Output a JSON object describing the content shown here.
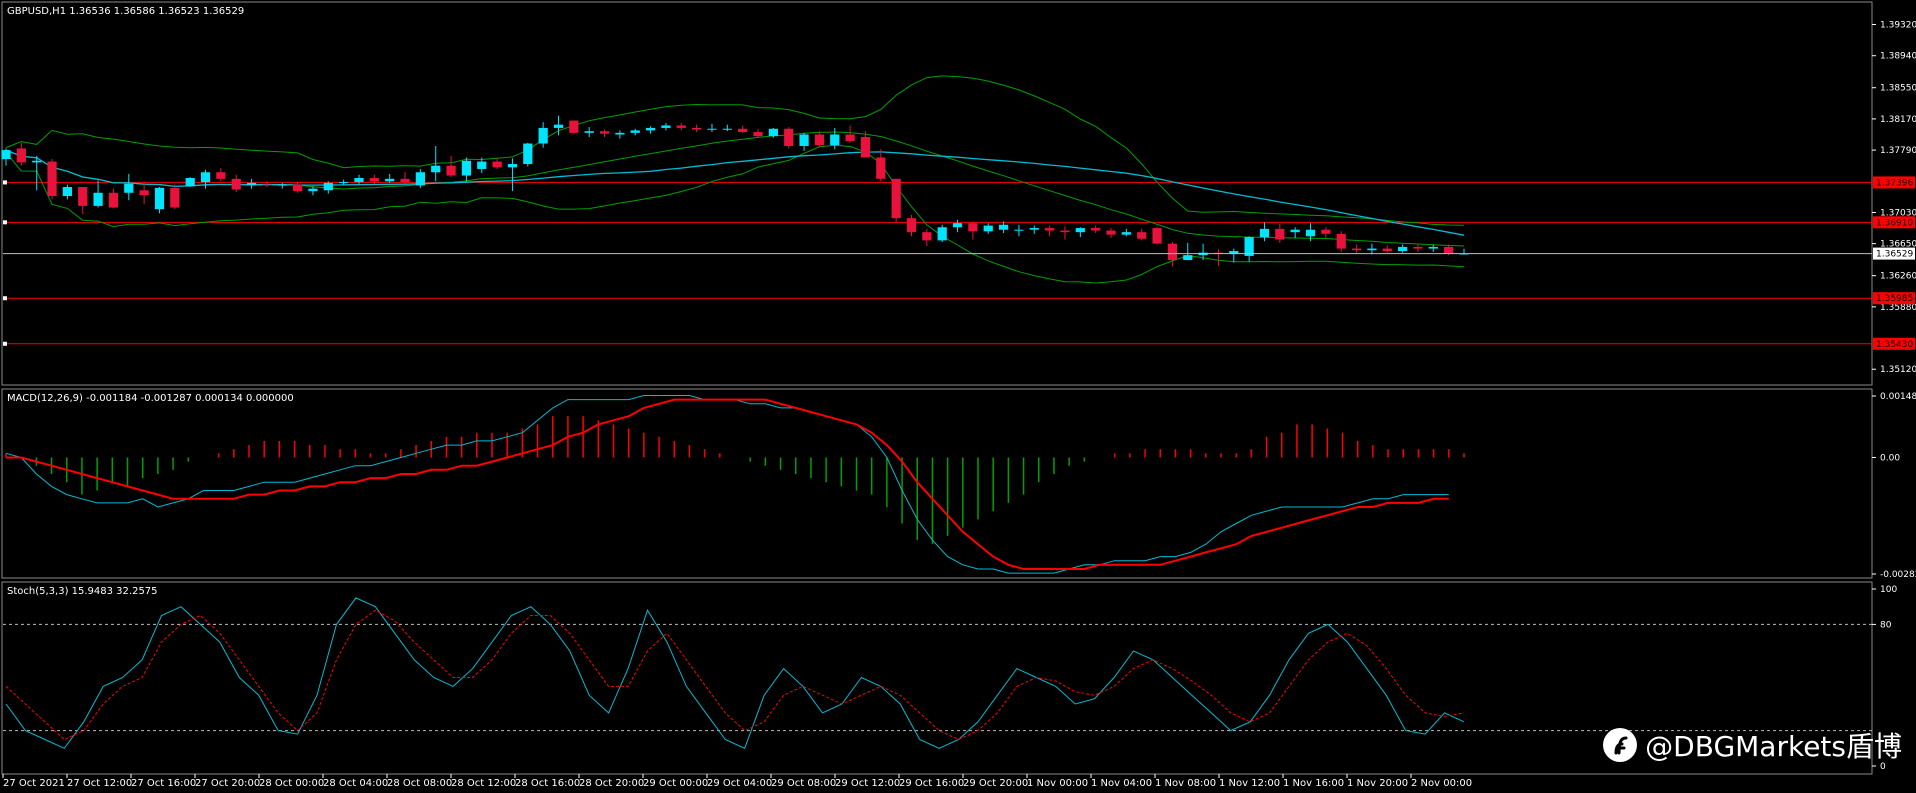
{
  "chart_data": [
    {
      "type": "candlestick",
      "title": "GBPUSD,H1  1.36536 1.36586 1.36523 1.36529",
      "symbol": "GBPUSD",
      "timeframe": "H1",
      "ylim": [
        1.3494,
        1.3957
      ],
      "y_ticks": [
        "1.39320",
        "1.38940",
        "1.38550",
        "1.38170",
        "1.37790",
        "1.37030",
        "1.36650",
        "1.36260",
        "1.35880",
        "1.35120"
      ],
      "current_price": "1.36529",
      "price_lines": [
        "1.37396",
        "1.36910",
        "1.35985",
        "1.35430"
      ],
      "bollinger": {
        "period": 20,
        "color": "#00a000"
      },
      "moving_average": {
        "color": "#00bcd4"
      },
      "colors": {
        "up": "#00e5ff",
        "down": "#e8123c",
        "level": "#ff0000"
      },
      "candles": [
        {
          "o": 1.3768,
          "h": 1.3781,
          "l": 1.376,
          "c": 1.3779
        },
        {
          "o": 1.3781,
          "h": 1.3788,
          "l": 1.376,
          "c": 1.3764
        },
        {
          "o": 1.3764,
          "h": 1.3772,
          "l": 1.373,
          "c": 1.3766
        },
        {
          "o": 1.3765,
          "h": 1.3768,
          "l": 1.3719,
          "c": 1.3723
        },
        {
          "o": 1.3723,
          "h": 1.3737,
          "l": 1.3719,
          "c": 1.3734
        },
        {
          "o": 1.3734,
          "h": 1.3734,
          "l": 1.3701,
          "c": 1.3711
        },
        {
          "o": 1.3711,
          "h": 1.3742,
          "l": 1.3709,
          "c": 1.3727
        },
        {
          "o": 1.3727,
          "h": 1.3732,
          "l": 1.3708,
          "c": 1.3709
        },
        {
          "o": 1.3727,
          "h": 1.375,
          "l": 1.3718,
          "c": 1.3738
        },
        {
          "o": 1.373,
          "h": 1.374,
          "l": 1.3713,
          "c": 1.3724
        },
        {
          "o": 1.3707,
          "h": 1.3734,
          "l": 1.3702,
          "c": 1.3733
        },
        {
          "o": 1.3733,
          "h": 1.3737,
          "l": 1.3707,
          "c": 1.3709
        },
        {
          "o": 1.3735,
          "h": 1.3746,
          "l": 1.3734,
          "c": 1.3745
        },
        {
          "o": 1.374,
          "h": 1.3755,
          "l": 1.3732,
          "c": 1.3752
        },
        {
          "o": 1.3752,
          "h": 1.3757,
          "l": 1.3741,
          "c": 1.3744
        },
        {
          "o": 1.3744,
          "h": 1.3749,
          "l": 1.3728,
          "c": 1.3731
        },
        {
          "o": 1.3736,
          "h": 1.3744,
          "l": 1.3732,
          "c": 1.3739
        },
        {
          "o": 1.3737,
          "h": 1.3741,
          "l": 1.3734,
          "c": 1.3736
        },
        {
          "o": 1.3736,
          "h": 1.3739,
          "l": 1.3732,
          "c": 1.3737
        },
        {
          "o": 1.3737,
          "h": 1.374,
          "l": 1.3727,
          "c": 1.3729
        },
        {
          "o": 1.3729,
          "h": 1.3735,
          "l": 1.3724,
          "c": 1.3732
        },
        {
          "o": 1.373,
          "h": 1.3741,
          "l": 1.3726,
          "c": 1.3739
        },
        {
          "o": 1.3739,
          "h": 1.3743,
          "l": 1.3736,
          "c": 1.374
        },
        {
          "o": 1.374,
          "h": 1.3749,
          "l": 1.3737,
          "c": 1.3745
        },
        {
          "o": 1.3745,
          "h": 1.3749,
          "l": 1.3738,
          "c": 1.3741
        },
        {
          "o": 1.3741,
          "h": 1.375,
          "l": 1.3739,
          "c": 1.3744
        },
        {
          "o": 1.3744,
          "h": 1.3752,
          "l": 1.3738,
          "c": 1.374
        },
        {
          "o": 1.3736,
          "h": 1.3756,
          "l": 1.3733,
          "c": 1.3752
        },
        {
          "o": 1.3752,
          "h": 1.3784,
          "l": 1.3741,
          "c": 1.376
        },
        {
          "o": 1.376,
          "h": 1.3772,
          "l": 1.3746,
          "c": 1.3748
        },
        {
          "o": 1.3748,
          "h": 1.377,
          "l": 1.3741,
          "c": 1.3766
        },
        {
          "o": 1.3756,
          "h": 1.377,
          "l": 1.3751,
          "c": 1.3765
        },
        {
          "o": 1.3765,
          "h": 1.377,
          "l": 1.3756,
          "c": 1.3758
        },
        {
          "o": 1.3758,
          "h": 1.3769,
          "l": 1.3729,
          "c": 1.3762
        },
        {
          "o": 1.3762,
          "h": 1.3788,
          "l": 1.3759,
          "c": 1.3787
        },
        {
          "o": 1.3787,
          "h": 1.3813,
          "l": 1.3782,
          "c": 1.3806
        },
        {
          "o": 1.3806,
          "h": 1.3821,
          "l": 1.3797,
          "c": 1.381
        },
        {
          "o": 1.3815,
          "h": 1.3815,
          "l": 1.3799,
          "c": 1.38
        },
        {
          "o": 1.38,
          "h": 1.3807,
          "l": 1.3795,
          "c": 1.3802
        },
        {
          "o": 1.3802,
          "h": 1.3804,
          "l": 1.3795,
          "c": 1.3799
        },
        {
          "o": 1.3798,
          "h": 1.3803,
          "l": 1.3793,
          "c": 1.38
        },
        {
          "o": 1.38,
          "h": 1.3805,
          "l": 1.3797,
          "c": 1.3803
        },
        {
          "o": 1.3803,
          "h": 1.3808,
          "l": 1.3799,
          "c": 1.3806
        },
        {
          "o": 1.3806,
          "h": 1.3812,
          "l": 1.3803,
          "c": 1.3809
        },
        {
          "o": 1.3809,
          "h": 1.3812,
          "l": 1.3803,
          "c": 1.3806
        },
        {
          "o": 1.3806,
          "h": 1.381,
          "l": 1.3801,
          "c": 1.3804
        },
        {
          "o": 1.3804,
          "h": 1.3811,
          "l": 1.3801,
          "c": 1.3805
        },
        {
          "o": 1.3805,
          "h": 1.381,
          "l": 1.3802,
          "c": 1.3805
        },
        {
          "o": 1.3805,
          "h": 1.3809,
          "l": 1.38,
          "c": 1.3801
        },
        {
          "o": 1.3801,
          "h": 1.3805,
          "l": 1.3794,
          "c": 1.3796
        },
        {
          "o": 1.3796,
          "h": 1.3806,
          "l": 1.3794,
          "c": 1.3805
        },
        {
          "o": 1.3805,
          "h": 1.3807,
          "l": 1.3781,
          "c": 1.3784
        },
        {
          "o": 1.3784,
          "h": 1.38,
          "l": 1.3778,
          "c": 1.3798
        },
        {
          "o": 1.3798,
          "h": 1.3802,
          "l": 1.3782,
          "c": 1.3785
        },
        {
          "o": 1.3785,
          "h": 1.3806,
          "l": 1.378,
          "c": 1.3798
        },
        {
          "o": 1.3798,
          "h": 1.3809,
          "l": 1.3788,
          "c": 1.379
        },
        {
          "o": 1.3795,
          "h": 1.3802,
          "l": 1.377,
          "c": 1.377
        },
        {
          "o": 1.377,
          "h": 1.378,
          "l": 1.3741,
          "c": 1.3744
        },
        {
          "o": 1.3744,
          "h": 1.3744,
          "l": 1.3691,
          "c": 1.3696
        },
        {
          "o": 1.3696,
          "h": 1.37,
          "l": 1.3674,
          "c": 1.3679
        },
        {
          "o": 1.3679,
          "h": 1.3683,
          "l": 1.3662,
          "c": 1.3669
        },
        {
          "o": 1.3669,
          "h": 1.3688,
          "l": 1.3667,
          "c": 1.3685
        },
        {
          "o": 1.3685,
          "h": 1.3694,
          "l": 1.3679,
          "c": 1.369
        },
        {
          "o": 1.369,
          "h": 1.3692,
          "l": 1.367,
          "c": 1.368
        },
        {
          "o": 1.368,
          "h": 1.369,
          "l": 1.3677,
          "c": 1.3687
        },
        {
          "o": 1.3682,
          "h": 1.3692,
          "l": 1.3678,
          "c": 1.3688
        },
        {
          "o": 1.3682,
          "h": 1.3688,
          "l": 1.3674,
          "c": 1.3682
        },
        {
          "o": 1.3682,
          "h": 1.3687,
          "l": 1.3677,
          "c": 1.3684
        },
        {
          "o": 1.3684,
          "h": 1.3687,
          "l": 1.3674,
          "c": 1.3681
        },
        {
          "o": 1.3681,
          "h": 1.3686,
          "l": 1.367,
          "c": 1.3679
        },
        {
          "o": 1.3679,
          "h": 1.3685,
          "l": 1.3673,
          "c": 1.3684
        },
        {
          "o": 1.3684,
          "h": 1.3687,
          "l": 1.3678,
          "c": 1.3681
        },
        {
          "o": 1.3681,
          "h": 1.3684,
          "l": 1.3672,
          "c": 1.3676
        },
        {
          "o": 1.3676,
          "h": 1.3683,
          "l": 1.3674,
          "c": 1.3679
        },
        {
          "o": 1.3679,
          "h": 1.3683,
          "l": 1.3669,
          "c": 1.3671
        },
        {
          "o": 1.3684,
          "h": 1.3685,
          "l": 1.3664,
          "c": 1.3665
        },
        {
          "o": 1.3665,
          "h": 1.3667,
          "l": 1.3637,
          "c": 1.3645
        },
        {
          "o": 1.3645,
          "h": 1.3666,
          "l": 1.3645,
          "c": 1.3651
        },
        {
          "o": 1.3651,
          "h": 1.3665,
          "l": 1.3645,
          "c": 1.3654
        },
        {
          "o": 1.3654,
          "h": 1.3658,
          "l": 1.3638,
          "c": 1.3653
        },
        {
          "o": 1.3653,
          "h": 1.3659,
          "l": 1.3642,
          "c": 1.3656
        },
        {
          "o": 1.365,
          "h": 1.3674,
          "l": 1.3643,
          "c": 1.3673
        },
        {
          "o": 1.3673,
          "h": 1.3691,
          "l": 1.3668,
          "c": 1.3683
        },
        {
          "o": 1.3683,
          "h": 1.3689,
          "l": 1.3666,
          "c": 1.367
        },
        {
          "o": 1.3679,
          "h": 1.3685,
          "l": 1.3672,
          "c": 1.3682
        },
        {
          "o": 1.3674,
          "h": 1.369,
          "l": 1.3668,
          "c": 1.3682
        },
        {
          "o": 1.3682,
          "h": 1.3685,
          "l": 1.3672,
          "c": 1.3677
        },
        {
          "o": 1.3677,
          "h": 1.368,
          "l": 1.3655,
          "c": 1.3659
        },
        {
          "o": 1.3659,
          "h": 1.3664,
          "l": 1.3654,
          "c": 1.3657
        },
        {
          "o": 1.3657,
          "h": 1.3665,
          "l": 1.3652,
          "c": 1.3659
        },
        {
          "o": 1.3659,
          "h": 1.3663,
          "l": 1.3654,
          "c": 1.3656
        },
        {
          "o": 1.3656,
          "h": 1.3664,
          "l": 1.3654,
          "c": 1.3661
        },
        {
          "o": 1.3661,
          "h": 1.3665,
          "l": 1.3655,
          "c": 1.3659
        },
        {
          "o": 1.3659,
          "h": 1.3664,
          "l": 1.3655,
          "c": 1.3661
        },
        {
          "o": 1.3661,
          "h": 1.3664,
          "l": 1.3651,
          "c": 1.3653
        },
        {
          "o": 1.3653,
          "h": 1.3659,
          "l": 1.3652,
          "c": 1.3653
        }
      ]
    },
    {
      "type": "bar",
      "title": "MACD(12,26,9) -0.001184 -0.001287 0.000134 0.000000",
      "ylim": [
        -0.002822,
        0.001488
      ],
      "y_ticks": [
        "0.001488",
        "0.00",
        "-0.002822"
      ],
      "colors": {
        "up": "#ff0000",
        "down": "#00a000",
        "macd": "#00bcd4",
        "signal": "#ff0000"
      },
      "histogram": [
        0.0001,
        0.0,
        -0.0002,
        -0.0004,
        -0.0006,
        -0.0009,
        -0.0008,
        -0.0006,
        -0.0007,
        -0.0005,
        -0.0004,
        -0.0003,
        -0.0001,
        0.0,
        0.0001,
        0.0002,
        0.0003,
        0.0004,
        0.0004,
        0.0004,
        0.0003,
        0.0003,
        0.0002,
        0.0002,
        0.0001,
        0.0001,
        0.0002,
        0.0003,
        0.0004,
        0.0005,
        0.0005,
        0.0006,
        0.0006,
        0.0006,
        0.0007,
        0.0008,
        0.001,
        0.001,
        0.001,
        0.0009,
        0.0008,
        0.0007,
        0.0006,
        0.0005,
        0.0004,
        0.0003,
        0.0002,
        0.0001,
        0.0,
        -0.0001,
        -0.0002,
        -0.0003,
        -0.0004,
        -0.0005,
        -0.0006,
        -0.0007,
        -0.0008,
        -0.0009,
        -0.0012,
        -0.0016,
        -0.002,
        -0.0021,
        -0.0019,
        -0.0017,
        -0.0015,
        -0.0013,
        -0.0011,
        -0.0009,
        -0.0006,
        -0.0004,
        -0.0002,
        -0.0001,
        0.0,
        0.0001,
        0.0001,
        0.0002,
        0.0002,
        0.0002,
        0.0002,
        0.0001,
        0.0001,
        0.0001,
        0.0002,
        0.0005,
        0.0006,
        0.0008,
        0.0008,
        0.0007,
        0.0006,
        0.0004,
        0.0003,
        0.0002,
        0.0002,
        0.0002,
        0.0002,
        0.0002,
        0.0001
      ],
      "macd": [
        0.0001,
        0.0,
        -0.0004,
        -0.0007,
        -0.0009,
        -0.001,
        -0.0011,
        -0.0011,
        -0.0011,
        -0.001,
        -0.0012,
        -0.0011,
        -0.001,
        -0.0008,
        -0.0008,
        -0.0008,
        -0.0007,
        -0.0006,
        -0.0006,
        -0.0006,
        -0.0005,
        -0.0004,
        -0.0003,
        -0.0002,
        -0.0002,
        -0.0001,
        0.0,
        0.0001,
        0.0002,
        0.0003,
        0.0003,
        0.0004,
        0.0004,
        0.0005,
        0.0006,
        0.0009,
        0.0012,
        0.0014,
        0.0014,
        0.0014,
        0.0014,
        0.0014,
        0.0015,
        0.0015,
        0.0015,
        0.0015,
        0.0014,
        0.0014,
        0.0014,
        0.0013,
        0.0013,
        0.0012,
        0.0012,
        0.0011,
        0.001,
        0.0009,
        0.0008,
        0.0005,
        0.0,
        -0.0008,
        -0.0015,
        -0.002,
        -0.0024,
        -0.0026,
        -0.0027,
        -0.0027,
        -0.0028,
        -0.0028,
        -0.0028,
        -0.0028,
        -0.0027,
        -0.0026,
        -0.0026,
        -0.0025,
        -0.0025,
        -0.0025,
        -0.0024,
        -0.0024,
        -0.0023,
        -0.0021,
        -0.0018,
        -0.0016,
        -0.0014,
        -0.0013,
        -0.0012,
        -0.0012,
        -0.0012,
        -0.0012,
        -0.0012,
        -0.0011,
        -0.001,
        -0.001,
        -0.0009,
        -0.0009,
        -0.0009,
        -0.0009
      ],
      "signal": [
        0.0,
        0.0,
        -0.0001,
        -0.0002,
        -0.0003,
        -0.0004,
        -0.0005,
        -0.0006,
        -0.0007,
        -0.0008,
        -0.0009,
        -0.001,
        -0.001,
        -0.001,
        -0.001,
        -0.001,
        -0.0009,
        -0.0009,
        -0.0008,
        -0.0008,
        -0.0007,
        -0.0007,
        -0.0006,
        -0.0006,
        -0.0005,
        -0.0005,
        -0.0004,
        -0.0004,
        -0.0003,
        -0.0003,
        -0.0002,
        -0.0002,
        -0.0001,
        0.0,
        0.0001,
        0.0002,
        0.0003,
        0.0005,
        0.0006,
        0.0008,
        0.0009,
        0.001,
        0.0012,
        0.0013,
        0.0014,
        0.0014,
        0.0014,
        0.0014,
        0.0014,
        0.0014,
        0.0014,
        0.0013,
        0.0012,
        0.0011,
        0.001,
        0.0009,
        0.0008,
        0.0006,
        0.0003,
        -0.0001,
        -0.0006,
        -0.001,
        -0.0014,
        -0.0018,
        -0.0021,
        -0.0024,
        -0.0026,
        -0.0027,
        -0.0027,
        -0.0027,
        -0.0027,
        -0.0027,
        -0.0026,
        -0.0026,
        -0.0026,
        -0.0026,
        -0.0026,
        -0.0025,
        -0.0024,
        -0.0023,
        -0.0022,
        -0.0021,
        -0.0019,
        -0.0018,
        -0.0017,
        -0.0016,
        -0.0015,
        -0.0014,
        -0.0013,
        -0.0012,
        -0.0012,
        -0.0011,
        -0.0011,
        -0.0011,
        -0.001,
        -0.001
      ]
    },
    {
      "type": "line",
      "title": "Stoch(5,3,3) 15.9483 32.2575",
      "ylim": [
        0,
        100
      ],
      "y_ticks": [
        "100",
        "80",
        "0"
      ],
      "levels": [
        80,
        20
      ],
      "colors": {
        "main": "#00bcd4",
        "signal": "#ff0000",
        "level": "#bbbbbb"
      },
      "main": [
        35,
        20,
        15,
        10,
        25,
        45,
        50,
        60,
        85,
        90,
        80,
        70,
        50,
        40,
        20,
        18,
        40,
        80,
        95,
        90,
        75,
        60,
        50,
        45,
        55,
        70,
        85,
        90,
        80,
        65,
        40,
        30,
        55,
        88,
        70,
        45,
        30,
        15,
        10,
        40,
        55,
        45,
        30,
        35,
        50,
        45,
        35,
        15,
        10,
        15,
        25,
        40,
        55,
        50,
        45,
        35,
        38,
        50,
        65,
        60,
        50,
        40,
        30,
        20,
        25,
        40,
        60,
        75,
        80,
        70,
        55,
        40,
        20,
        18,
        30,
        25
      ],
      "signal": [
        45,
        35,
        25,
        15,
        20,
        35,
        45,
        50,
        70,
        80,
        85,
        75,
        60,
        45,
        30,
        20,
        30,
        60,
        80,
        88,
        82,
        70,
        60,
        50,
        50,
        60,
        75,
        85,
        85,
        75,
        60,
        45,
        45,
        65,
        75,
        60,
        45,
        30,
        20,
        25,
        40,
        45,
        40,
        35,
        40,
        45,
        40,
        30,
        20,
        15,
        20,
        30,
        45,
        50,
        48,
        42,
        40,
        45,
        55,
        60,
        55,
        48,
        40,
        30,
        25,
        30,
        45,
        60,
        70,
        75,
        68,
        55,
        40,
        30,
        28,
        30
      ]
    }
  ],
  "time_axis": {
    "labels": [
      "27 Oct 2021",
      "27 Oct 12:00",
      "27 Oct 16:00",
      "27 Oct 20:00",
      "28 Oct 00:00",
      "28 Oct 04:00",
      "28 Oct 08:00",
      "28 Oct 12:00",
      "28 Oct 16:00",
      "28 Oct 20:00",
      "29 Oct 00:00",
      "29 Oct 04:00",
      "29 Oct 08:00",
      "29 Oct 12:00",
      "29 Oct 16:00",
      "29 Oct 20:00",
      "1 Nov 00:00",
      "1 Nov 04:00",
      "1 Nov 08:00",
      "1 Nov 12:00",
      "1 Nov 16:00",
      "1 Nov 20:00",
      "2 Nov 00:00"
    ]
  },
  "watermark": {
    "text": "@DBGMarkets盾博",
    "logo_icon": "weibo-like-f-logo-icon"
  }
}
